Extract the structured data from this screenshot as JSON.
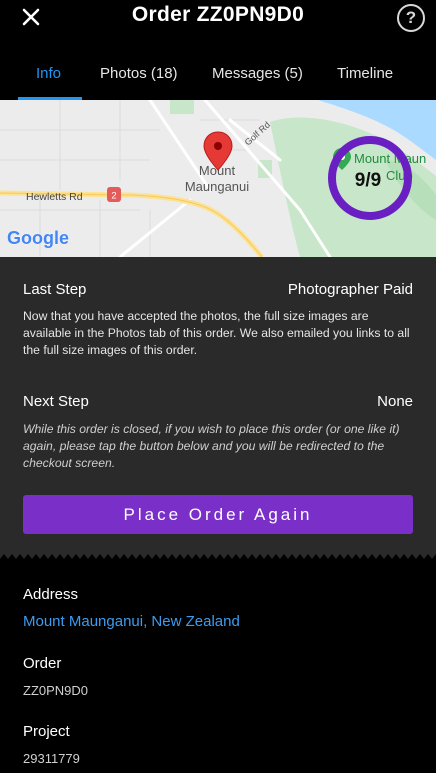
{
  "header": {
    "title": "Order ZZ0PN9D0",
    "help_glyph": "?"
  },
  "tabs": [
    {
      "label": "Info",
      "active": true
    },
    {
      "label": "Photos (18)",
      "active": false
    },
    {
      "label": "Messages (5)",
      "active": false
    },
    {
      "label": "Timeline",
      "active": false
    }
  ],
  "map": {
    "road_golf": "Golf Rd",
    "road_hewletts": "Hewletts Rd",
    "route_shield": "2",
    "place_line1": "Mount",
    "place_line2": "Maunganui",
    "poi_line1": "Mount Maun",
    "poi_line2": "Club",
    "progress_text": "9/9",
    "progress_fraction": 1.0,
    "logo_text": "Google",
    "colors": {
      "progress_ring": "#6a1fc2",
      "pin": "#e53935"
    }
  },
  "info": {
    "last_step_label": "Last Step",
    "last_step_value": "Photographer Paid",
    "last_step_text": "Now that you have accepted the photos, the full size images are available in the Photos tab of this order. We also emailed you links to all the full size images of this order.",
    "next_step_label": "Next Step",
    "next_step_value": "None",
    "next_step_text": "While this order is closed, if you wish to place this order (or one like it) again, please tap the button below and you will be redirected to the checkout screen.",
    "button_label": "Place Order Again"
  },
  "details": {
    "address_label": "Address",
    "address_value": "Mount Maunganui, New Zealand",
    "order_label": "Order",
    "order_value": "ZZ0PN9D0",
    "project_label": "Project",
    "project_value": "29311779"
  },
  "colors": {
    "accent": "#2196f3",
    "button": "#7b2fc9",
    "link": "#3d9cf0"
  }
}
